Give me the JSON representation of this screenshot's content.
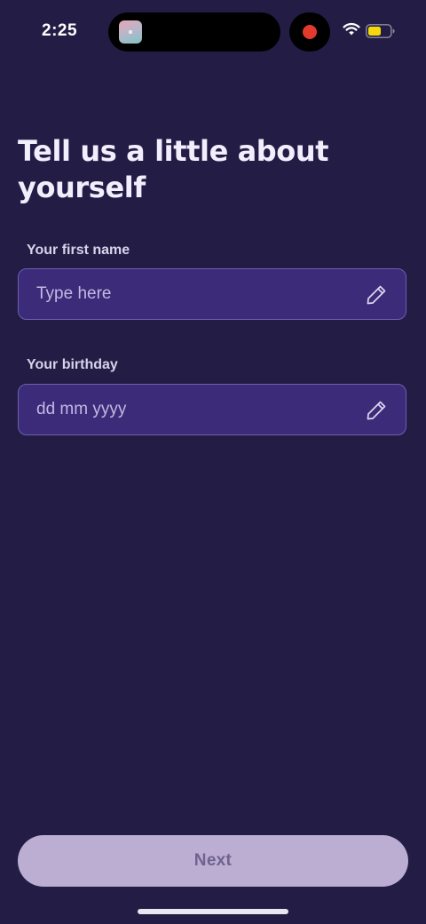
{
  "status_bar": {
    "time": "2:25"
  },
  "page": {
    "title": "Tell us a little about yourself"
  },
  "fields": {
    "first_name": {
      "label": "Your first name",
      "placeholder": "Type here",
      "value": ""
    },
    "birthday": {
      "label": "Your birthday",
      "placeholder": "dd mm yyyy",
      "value": ""
    }
  },
  "actions": {
    "next_label": "Next"
  },
  "icons": {
    "edit": "pencil-icon",
    "wifi": "wifi-icon",
    "battery": "battery-icon",
    "recording": "recording-indicator"
  },
  "colors": {
    "background": "#231d46",
    "input_fill": "#3b2b78",
    "input_border": "#6d5fb0",
    "button_fill": "#bcadd2",
    "button_text": "#6e6390",
    "recording_dot": "#e23a2c",
    "battery_fill": "#f5d90a"
  }
}
